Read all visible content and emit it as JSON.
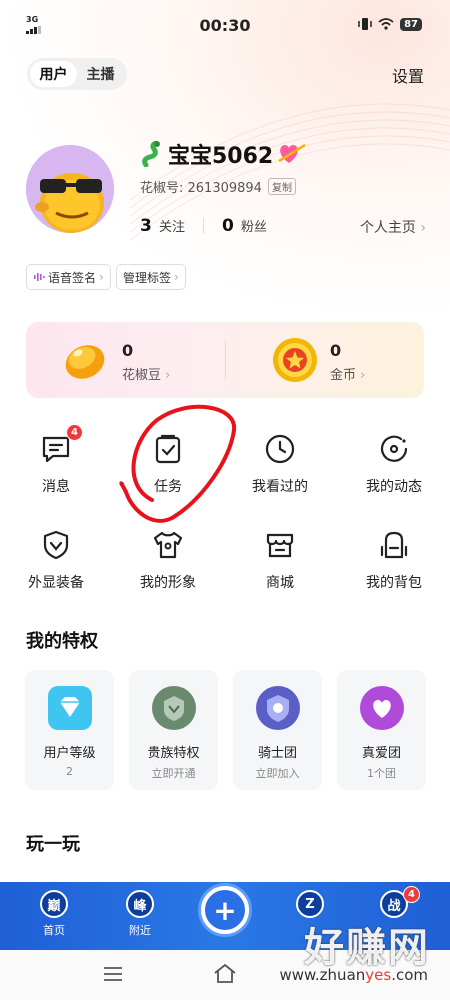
{
  "status_bar": {
    "network": "3G",
    "time": "00:30",
    "battery": "87"
  },
  "header": {
    "tabs": [
      {
        "label": "用户",
        "active": true
      },
      {
        "label": "主播",
        "active": false
      }
    ],
    "settings_label": "设置"
  },
  "profile": {
    "name": "宝宝5062",
    "id_label": "花椒号: 261309894",
    "copy_label": "复制",
    "following_count": "3",
    "following_label": "关注",
    "fans_count": "0",
    "fans_label": "粉丝",
    "homepage_label": "个人主页"
  },
  "chips": {
    "voice_signature": "语音签名",
    "manage_tags": "管理标签"
  },
  "wallet": {
    "beans_value": "0",
    "beans_label": "花椒豆",
    "coins_value": "0",
    "coins_label": "金币"
  },
  "grid": {
    "messages": {
      "label": "消息",
      "badge": "4"
    },
    "tasks": {
      "label": "任务"
    },
    "history": {
      "label": "我看过的"
    },
    "moments": {
      "label": "我的动态"
    },
    "outfit": {
      "label": "外显装备"
    },
    "image": {
      "label": "我的形象"
    },
    "mall": {
      "label": "商城"
    },
    "backpack": {
      "label": "我的背包"
    }
  },
  "privileges": {
    "title": "我的特权",
    "items": [
      {
        "name": "用户等级",
        "sub": "2",
        "color": "#3ec6f0"
      },
      {
        "name": "贵族特权",
        "sub": "立即开通",
        "color": "#6a8a70"
      },
      {
        "name": "骑士团",
        "sub": "立即加入",
        "color": "#5a5fc8"
      },
      {
        "name": "真爱团",
        "sub": "1个团",
        "color": "#b04ad8"
      }
    ]
  },
  "play_title": "玩一玩",
  "tabbar": {
    "home_label": "首页",
    "nearby_label": "附近",
    "war_badge": "4"
  },
  "watermark": {
    "text": "好赚网",
    "url_prefix": "www.zhuan",
    "url_highlight": "yes",
    "url_suffix": ".com"
  },
  "colors": {
    "accent": "#2a78e6",
    "badge": "#f03a3a"
  }
}
